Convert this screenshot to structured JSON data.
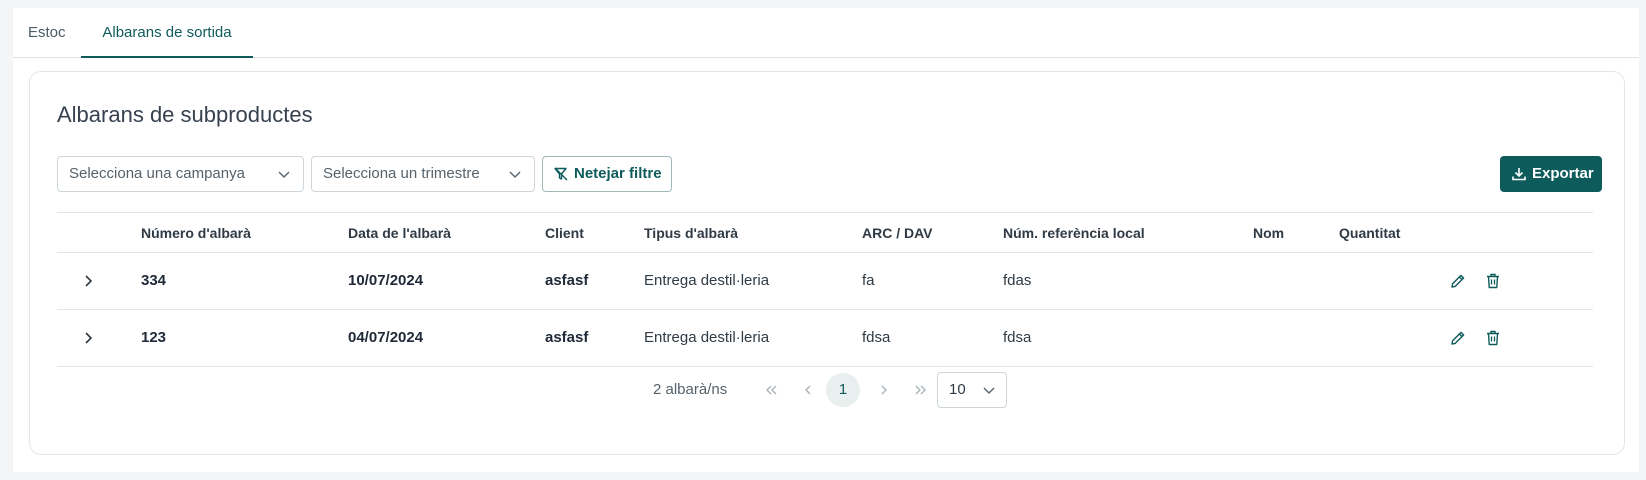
{
  "tabs": [
    {
      "label": "Estoc",
      "active": false
    },
    {
      "label": "Albarans de sortida",
      "active": true
    }
  ],
  "card": {
    "title": "Albarans de subproductes"
  },
  "filters": {
    "campaign_placeholder": "Selecciona una campanya",
    "quarter_placeholder": "Selecciona un trimestre",
    "clear_label": "Netejar filtre"
  },
  "export_label": "Exportar",
  "table": {
    "headers": [
      "Número d'albarà",
      "Data de l'albarà",
      "Client",
      "Tipus d'albarà",
      "ARC / DAV",
      "Núm. referència local",
      "Nom",
      "Quantitat"
    ],
    "rows": [
      {
        "numero": "334",
        "data": "10/07/2024",
        "client": "asfasf",
        "tipus": "Entrega destil·leria",
        "arc": "fa",
        "ref": "fdas",
        "nom": "",
        "quantitat": ""
      },
      {
        "numero": "123",
        "data": "04/07/2024",
        "client": "asfasf",
        "tipus": "Entrega destil·leria",
        "arc": "fdsa",
        "ref": "fdsa",
        "nom": "",
        "quantitat": ""
      }
    ]
  },
  "pagination": {
    "count_text": "2 albarà/ns",
    "current_page": "1",
    "page_size": "10"
  },
  "colors": {
    "accent": "#0e5b5c",
    "border": "#e3e6e8"
  },
  "icons": [
    "chevron-down-icon",
    "filter-clear-icon",
    "download-icon",
    "chevron-right-icon",
    "edit-icon",
    "trash-icon",
    "double-chevron-left-icon",
    "chevron-left-icon",
    "double-chevron-right-icon"
  ]
}
